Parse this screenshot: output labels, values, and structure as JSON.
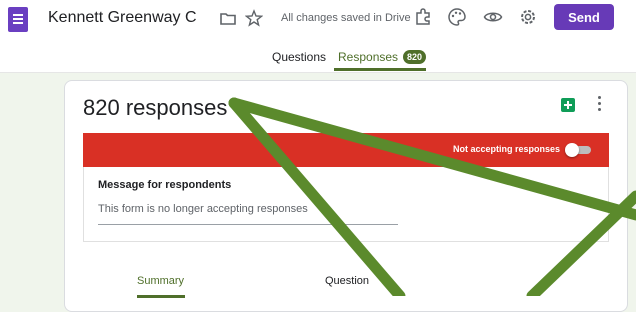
{
  "header": {
    "title": "Kennett Greenway Commur",
    "saved_status": "All changes saved in Drive",
    "send_label": "Send",
    "icons": [
      "forms-logo-icon",
      "folder-icon",
      "star-icon",
      "addon-icon",
      "palette-icon",
      "eye-icon",
      "gear-icon"
    ]
  },
  "tabs": [
    {
      "label": "Questions"
    },
    {
      "label": "Responses",
      "badge": "820"
    }
  ],
  "card": {
    "title": "820 responses",
    "accepting_label": "Not accepting responses",
    "accepting": false,
    "message_label": "Message for respondents",
    "message_value": "This form is no longer accepting responses"
  },
  "subtabs": [
    {
      "label": "Summary"
    },
    {
      "label": "Question"
    }
  ],
  "colors": {
    "accent": "#4f6f2a",
    "brand": "#673ab7",
    "banner": "#d93025",
    "overlay_stroke": "#5b8a2c",
    "page_bg": "#f0f5ec"
  }
}
